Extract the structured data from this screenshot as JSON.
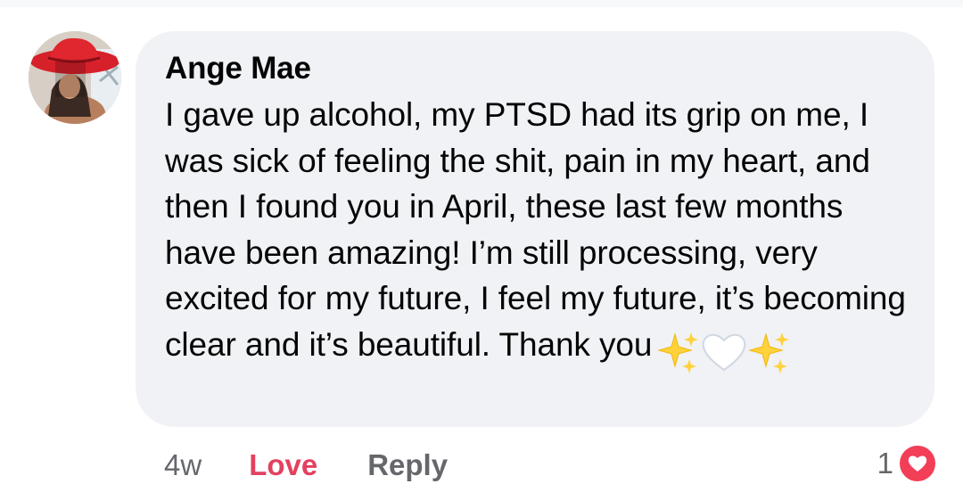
{
  "comment": {
    "author": "Ange Mae",
    "text": "I gave up alcohol, my PTSD had its grip on me, I was sick of feeling the shit, pain in my heart, and then I found you in April, these last few months have been amazing! I’m still processing, very excited for my future, I feel my future, it’s becoming clear and it’s beautiful. Thank you",
    "emojis": [
      "sparkles-icon",
      "white-heart-icon",
      "sparkles-icon"
    ]
  },
  "actions": {
    "time": "4w",
    "love_label": "Love",
    "reply_label": "Reply"
  },
  "reactions": {
    "count": "1",
    "icon": "love-reaction-icon"
  },
  "colors": {
    "bubble": "#f0f2f5",
    "love": "#e4405f",
    "muted": "#65676b",
    "heart": "#f33e58"
  }
}
